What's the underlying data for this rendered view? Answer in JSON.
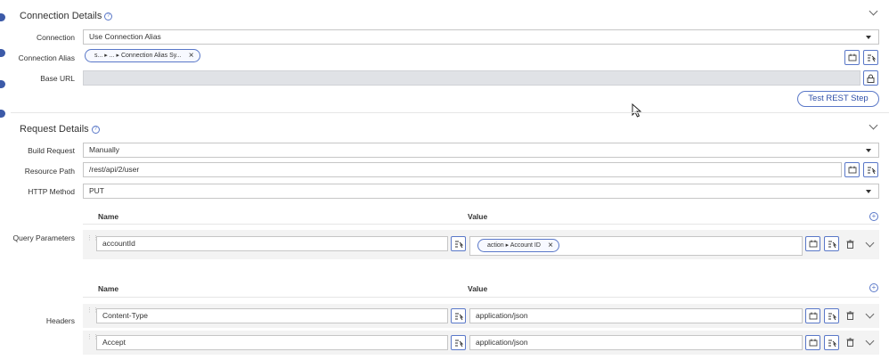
{
  "connection_details": {
    "title": "Connection Details",
    "connection": {
      "label": "Connection",
      "value": "Use Connection Alias"
    },
    "alias": {
      "label": "Connection Alias",
      "chip": "s... ▸ ... ▸ Connection Alias Sy..."
    },
    "base_url": {
      "label": "Base URL",
      "value": ""
    },
    "test_button": "Test REST Step"
  },
  "request_details": {
    "title": "Request Details",
    "build_request": {
      "label": "Build Request",
      "value": "Manually"
    },
    "resource_path": {
      "label": "Resource Path",
      "value": "/rest/api/2/user"
    },
    "http_method": {
      "label": "HTTP Method",
      "value": "PUT"
    },
    "query_parameters": {
      "label": "Query Parameters",
      "col_name": "Name",
      "col_value": "Value",
      "rows": [
        {
          "name": "accountId",
          "value_chip": "action ▸ Account ID"
        }
      ]
    },
    "headers": {
      "label": "Headers",
      "col_name": "Name",
      "col_value": "Value",
      "rows": [
        {
          "name": "Content-Type",
          "value": "application/json"
        },
        {
          "name": "Accept",
          "value": "application/json"
        }
      ]
    }
  },
  "colors": {
    "accent": "#5a78c8",
    "disabled_field": "#e0e2e6"
  },
  "icons": [
    "help-icon",
    "chevron-down-icon",
    "calendar-icon",
    "variable-picker-icon",
    "lock-icon",
    "plus-circle-icon",
    "trash-icon",
    "drag-handle-icon",
    "mouse-cursor-icon"
  ]
}
